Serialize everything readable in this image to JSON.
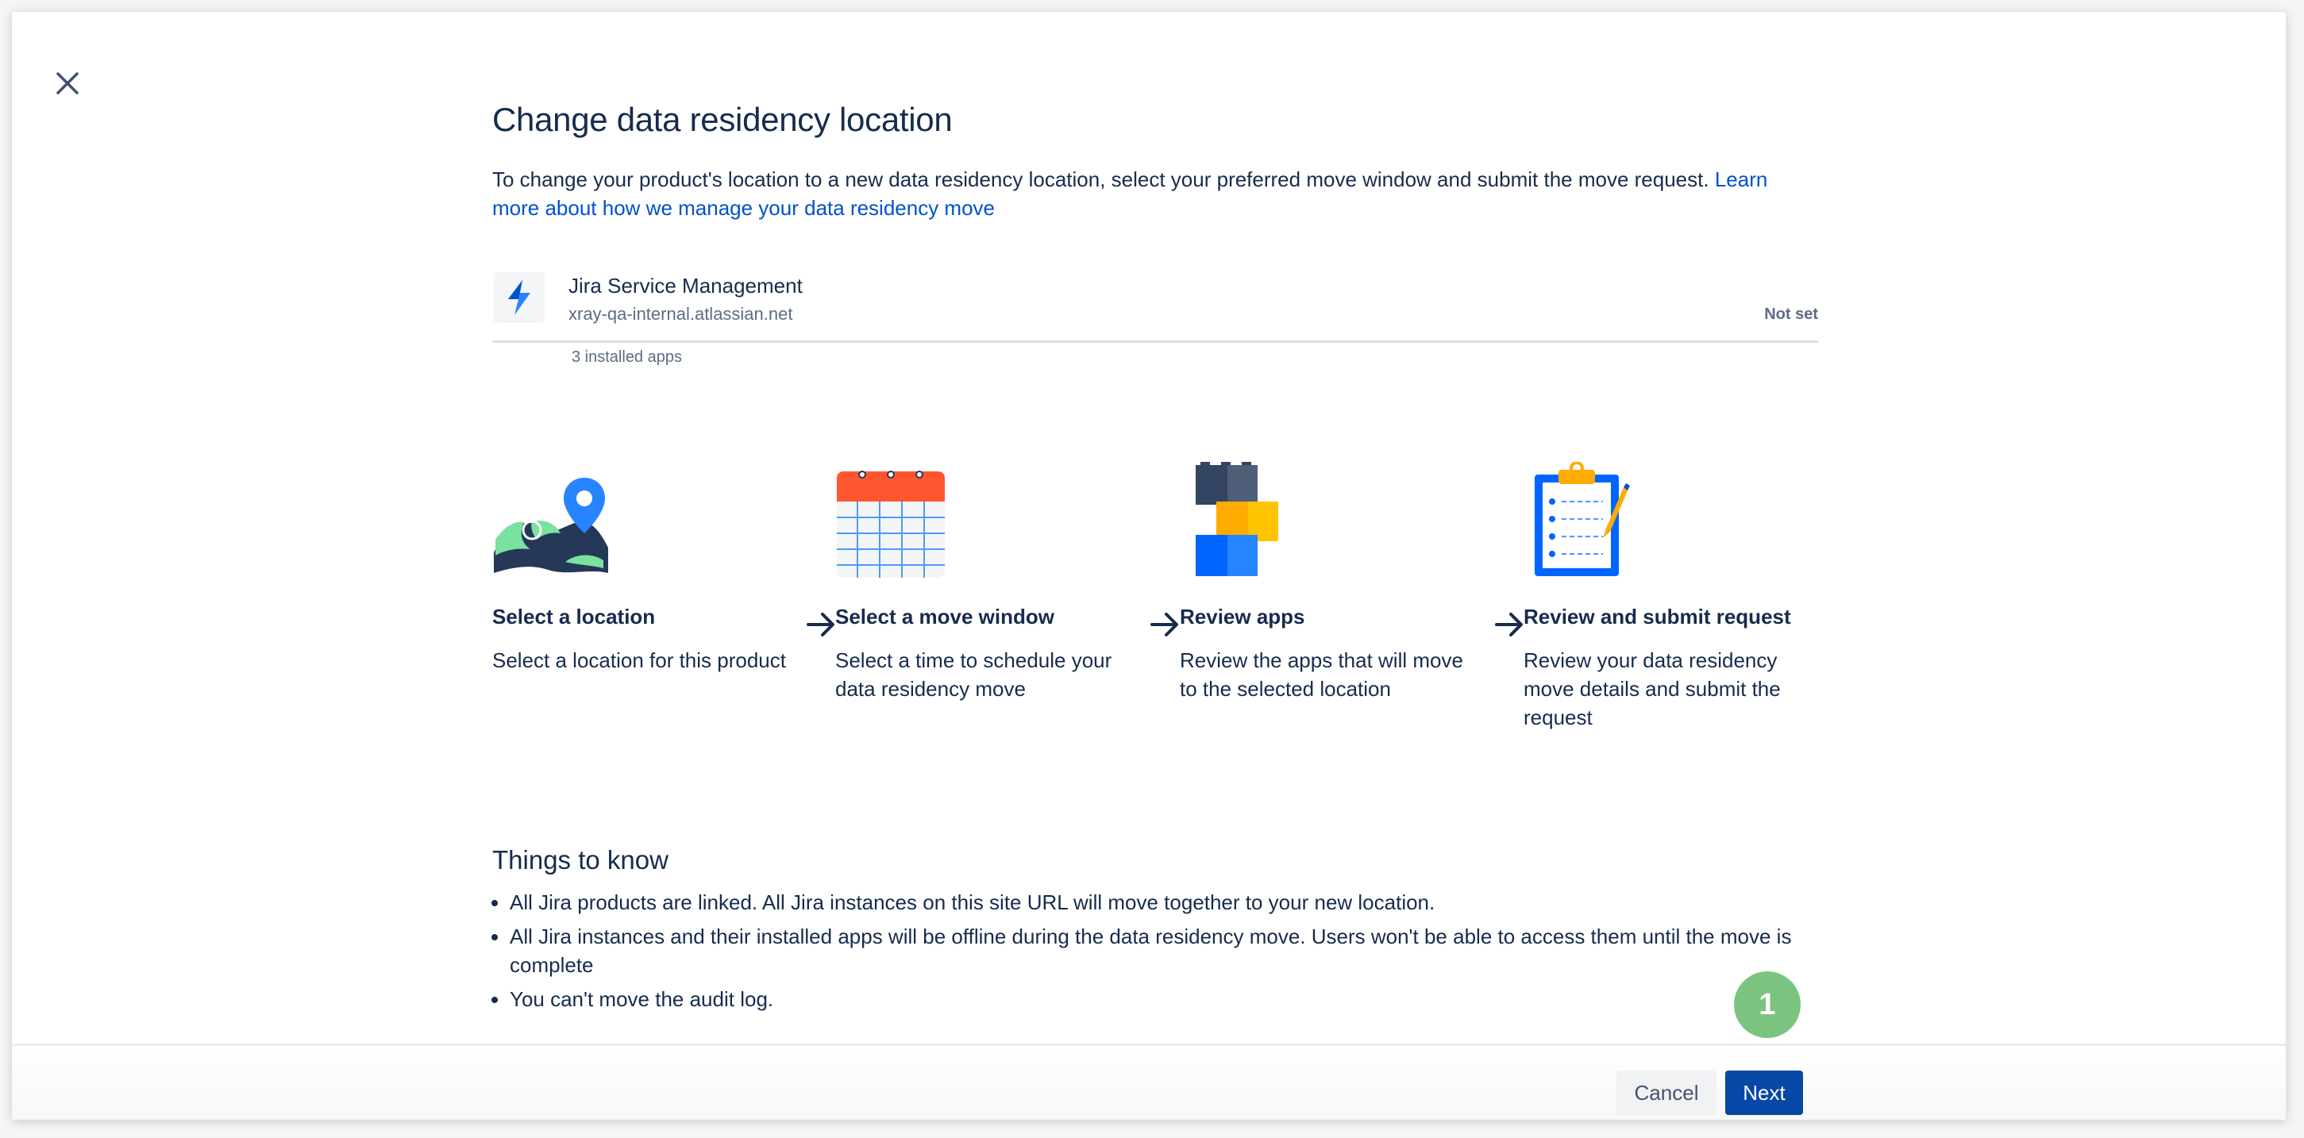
{
  "dialog": {
    "title": "Change data residency location",
    "intro_text": "To change your product's location to a new data residency location, select your preferred move window and submit the move request. ",
    "learn_more_link": "Learn more about how we manage your data residency move"
  },
  "product": {
    "name": "Jira Service Management",
    "url": "xray-qa-internal.atlassian.net",
    "status": "Not set",
    "installed_apps": "3 installed apps"
  },
  "steps": [
    {
      "title": "Select a location",
      "description": "Select a location for this product"
    },
    {
      "title": "Select a move window",
      "description": "Select a time to schedule your data residency move"
    },
    {
      "title": "Review apps",
      "description": "Review the apps that will move to the selected location"
    },
    {
      "title": "Review and submit request",
      "description": "Review your data residency move details and submit the request"
    }
  ],
  "things_to_know": {
    "title": "Things to know",
    "items": [
      "All Jira products are linked. All Jira instances on this site URL will move together to your new location.",
      "All Jira instances and their installed apps will be offline during the data residency move. Users won't be able to access them until the move is complete",
      "You can't move the audit log."
    ]
  },
  "footer": {
    "cancel_label": "Cancel",
    "next_label": "Next",
    "step_marker": "1"
  },
  "colors": {
    "primary": "#0747a6",
    "link": "#0052cc",
    "text": "#172b4d",
    "marker": "#7bc47f"
  },
  "icons": [
    "close-icon",
    "jira-service-management-icon",
    "map-pin-icon",
    "calendar-icon",
    "blocks-icon",
    "clipboard-icon",
    "arrow-right-icon"
  ]
}
